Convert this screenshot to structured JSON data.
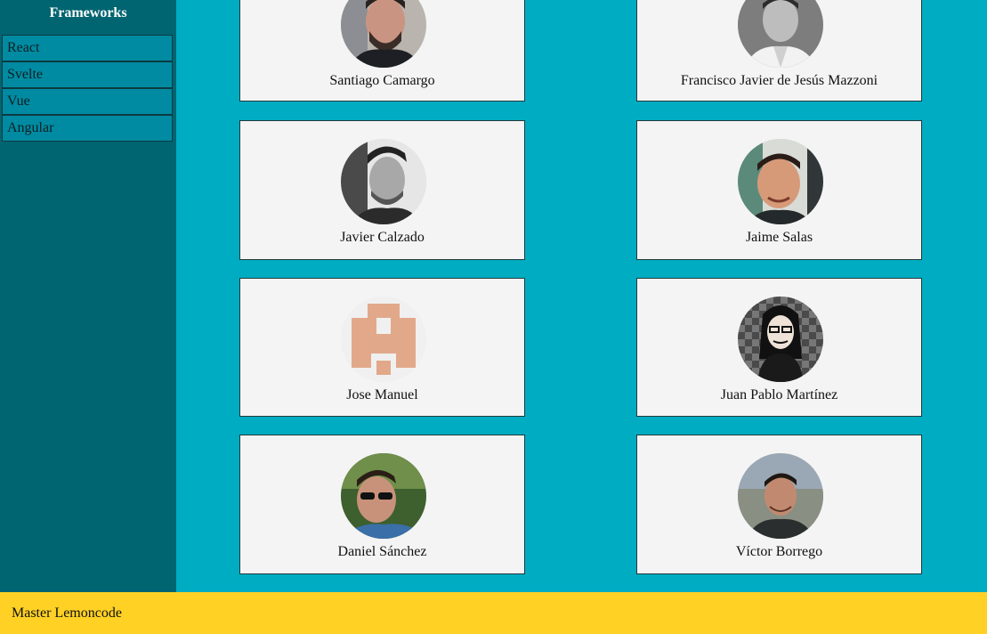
{
  "sidebar": {
    "title": "Frameworks",
    "items": [
      {
        "label": "React"
      },
      {
        "label": "Svelte"
      },
      {
        "label": "Vue"
      },
      {
        "label": "Angular"
      }
    ]
  },
  "members": [
    {
      "name": "Santiago Camargo",
      "avatar_style": "photo-color"
    },
    {
      "name": "Francisco Javier de Jesús Mazzoni",
      "avatar_style": "photo-grayscale"
    },
    {
      "name": "Javier Calzado",
      "avatar_style": "photo-grayscale"
    },
    {
      "name": "Jaime Salas",
      "avatar_style": "photo-color"
    },
    {
      "name": "Jose Manuel",
      "avatar_style": "identicon"
    },
    {
      "name": "Juan Pablo Martínez",
      "avatar_style": "cartoon"
    },
    {
      "name": "Daniel Sánchez",
      "avatar_style": "photo-color"
    },
    {
      "name": "Víctor Borrego",
      "avatar_style": "photo-color"
    }
  ],
  "footer": {
    "text": "Master Lemoncode"
  },
  "colors": {
    "sidebar_bg": "#006571",
    "nav_item_bg": "#008ba2",
    "main_bg": "#00acc1",
    "card_bg": "#f4f4f4",
    "footer_bg": "#ffd125"
  }
}
